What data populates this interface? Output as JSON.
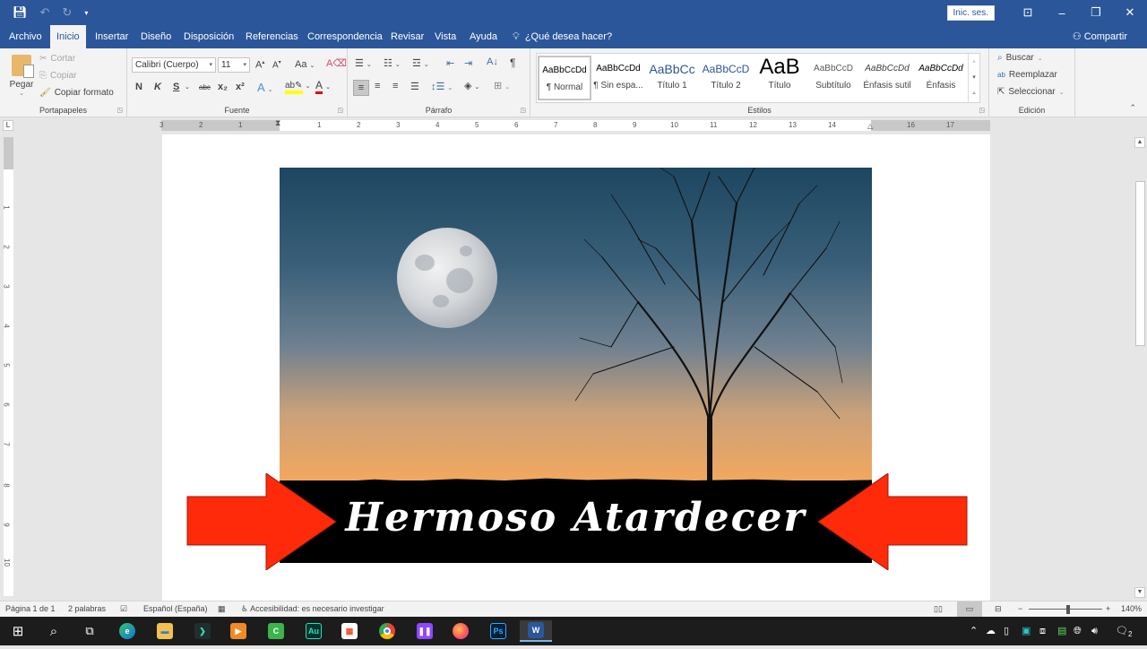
{
  "app": {
    "signin_label": "Inic. ses.",
    "share_label": "Compartir",
    "tell_me": "¿Qué desea hacer?"
  },
  "tabs": [
    "Archivo",
    "Inicio",
    "Insertar",
    "Diseño",
    "Disposición",
    "Referencias",
    "Correspondencia",
    "Revisar",
    "Vista",
    "Ayuda"
  ],
  "active_tab": "Inicio",
  "clipboard": {
    "paste": "Pegar",
    "cut": "Cortar",
    "copy": "Copiar",
    "format_painter": "Copiar formato",
    "label": "Portapapeles"
  },
  "font": {
    "family": "Calibri (Cuerpo)",
    "size": "11",
    "bold": "N",
    "italic": "K",
    "underline": "S",
    "strike": "abc",
    "subscript": "x₂",
    "superscript": "x²",
    "grow": "A",
    "shrink": "A",
    "case": "Aa",
    "label": "Fuente",
    "highlight_color": "#ffff00",
    "font_color": "#e00000"
  },
  "paragraph": {
    "label": "Párrafo",
    "pilcrow": "¶"
  },
  "styles": {
    "label": "Estilos",
    "items": [
      {
        "preview": "AaBbCcDd",
        "name": "¶ Normal"
      },
      {
        "preview": "AaBbCcDd",
        "name": "¶ Sin espa..."
      },
      {
        "preview": "AaBbCc",
        "name": "Título 1"
      },
      {
        "preview": "AaBbCcD",
        "name": "Título 2"
      },
      {
        "preview": "AaB",
        "name": "Título"
      },
      {
        "preview": "AaBbCcD",
        "name": "Subtítulo"
      },
      {
        "preview": "AaBbCcDd",
        "name": "Énfasis sutil"
      },
      {
        "preview": "AaBbCcDd",
        "name": "Énfasis"
      }
    ]
  },
  "editing": {
    "find": "Buscar",
    "replace": "Reemplazar",
    "select": "Seleccionar",
    "label": "Edición"
  },
  "ruler": {
    "h_left": [
      "3",
      "2",
      "1"
    ],
    "h_right": [
      "1",
      "2",
      "3",
      "4",
      "5",
      "6",
      "7",
      "8",
      "9",
      "10",
      "11",
      "12",
      "13",
      "14",
      "16",
      "17"
    ],
    "v": [
      "1",
      "2",
      "3",
      "4",
      "5",
      "6",
      "7",
      "8",
      "9",
      "10"
    ]
  },
  "document": {
    "banner_text": "Hermoso Atardecer",
    "arrow_color": "#ff2a0a"
  },
  "status": {
    "page": "Página 1 de 1",
    "words": "2 palabras",
    "language": "Español (España)",
    "accessibility": "Accesibilidad: es necesario investigar",
    "zoom": "140%",
    "zoom_level_percent": 140
  },
  "taskbar": {
    "apps": [
      "windows",
      "search",
      "task-view",
      "edge",
      "file-explorer",
      "filmora",
      "vlc-player",
      "camtasia",
      "audition",
      "store",
      "chrome",
      "twitch",
      "firefox",
      "photoshop",
      "word"
    ],
    "notification_count": "2"
  }
}
